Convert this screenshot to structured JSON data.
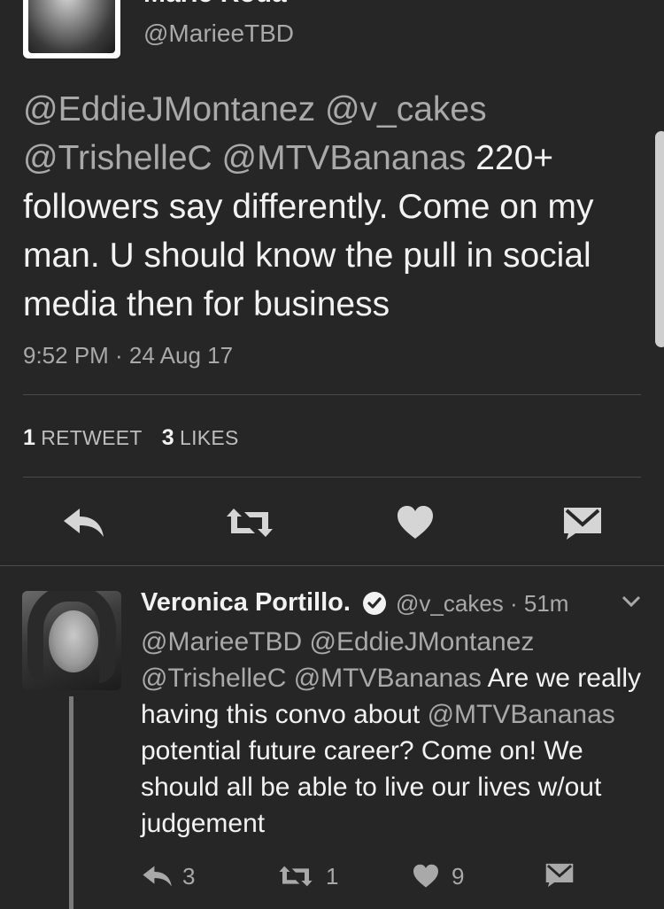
{
  "top_tweet": {
    "name": "Marie Roda",
    "handle": "@MarieeTBD",
    "mentions_line1": "@EddieJMontanez @v_cakes",
    "mentions_line2": "@TrishelleC @MTVBananas",
    "text_after_mentions": " 220+ followers say differently. Come on my man. U should know the pull in social media then for business",
    "timestamp": "9:52 PM · 24 Aug 17",
    "retweets_count": "1",
    "retweets_label": "RETWEET",
    "likes_count": "3",
    "likes_label": "LIKES",
    "actions": [
      "reply-icon",
      "retweet-icon",
      "heart-icon",
      "direct-message-icon"
    ]
  },
  "reply_tweet": {
    "name": "Veronica Portillo.",
    "handle_time": "@v_cakes · 51m",
    "mentions_line1": "@MarieeTBD @EddieJMontanez",
    "mentions_line2": "@TrishelleC @MTVBananas",
    "text_part1": " Are we really having this convo about ",
    "mention_inline": "@MTVBananas",
    "text_part2": " potential future career? Come on!  We should all be able to live our lives w/out judgement",
    "reply_count": "3",
    "retweet_count": "1",
    "like_count": "9"
  },
  "colors": {
    "background": "#262626",
    "text_primary": "#f2f2f2",
    "text_secondary": "#a9a9a9",
    "divider": "#4a4a4a"
  }
}
